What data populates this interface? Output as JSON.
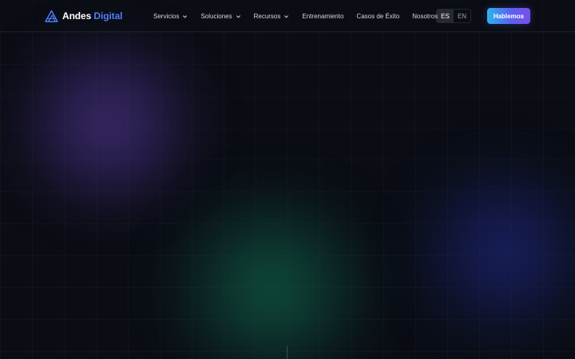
{
  "brand": {
    "name_primary": "Andes",
    "name_accent": "Digital",
    "logo_icon": "mountain-logo-icon",
    "accent_color": "#4f7cff"
  },
  "nav": {
    "items": [
      {
        "label": "Servicios",
        "has_dropdown": true
      },
      {
        "label": "Soluciones",
        "has_dropdown": true
      },
      {
        "label": "Recursos",
        "has_dropdown": true
      },
      {
        "label": "Entrenamiento",
        "has_dropdown": false
      },
      {
        "label": "Casos de Éxito",
        "has_dropdown": false
      },
      {
        "label": "Nosotros",
        "has_dropdown": false
      }
    ],
    "dropdown_icon": "chevron-down-icon"
  },
  "language": {
    "options": [
      "ES",
      "EN"
    ],
    "selected": "ES"
  },
  "cta": {
    "label": "Hablemos",
    "gradient": [
      "#2bb6e8",
      "#5b5ff2",
      "#7a4fe8"
    ]
  },
  "theme": {
    "background": "#0a0d14",
    "glow_colors": [
      "#6c46be",
      "#148c64",
      "#2832aa"
    ]
  }
}
